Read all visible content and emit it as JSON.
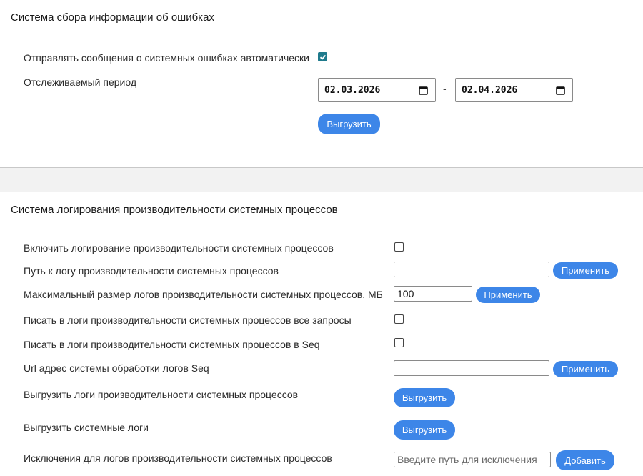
{
  "errors_section": {
    "title": "Система сбора информации об ошибках",
    "auto_send_label": "Отправлять сообщения о системных ошибках автоматически",
    "auto_send_checked": true,
    "period_label": "Отслеживаемый период",
    "date_from": "02.03.2026",
    "date_separator": "-",
    "date_to": "02.04.2026",
    "export_button": "Выгрузить"
  },
  "perf_section": {
    "title": "Система логирования производительности системных процессов",
    "enable_label": "Включить логирование производительности системных процессов",
    "enable_checked": false,
    "log_path_label": "Путь к логу производительности системных процессов",
    "log_path_value": "",
    "log_path_apply": "Применить",
    "max_size_label": "Максимальный размер логов производительности системных процессов, МБ",
    "max_size_value": "100",
    "max_size_apply": "Применить",
    "all_requests_label": "Писать в логи производительности системных процессов все запросы",
    "all_requests_checked": false,
    "seq_label": "Писать в логи производительности системных процессов в Seq",
    "seq_checked": false,
    "seq_url_label": "Url адрес системы обработки логов Seq",
    "seq_url_value": "",
    "seq_url_apply": "Применить",
    "export_perf_label": "Выгрузить логи производительности системных процессов",
    "export_perf_button": "Выгрузить",
    "export_sys_label": "Выгрузить системные логи",
    "export_sys_button": "Выгрузить",
    "exclusions_label": "Исключения для логов производительности системных процессов",
    "exclusions_placeholder": "Введите путь для исключения",
    "exclusions_add": "Добавить"
  },
  "colors": {
    "accent": "#3d86e8",
    "checkbox_checked": "#1f7a8c",
    "divider_band": "#f2f2f2"
  }
}
